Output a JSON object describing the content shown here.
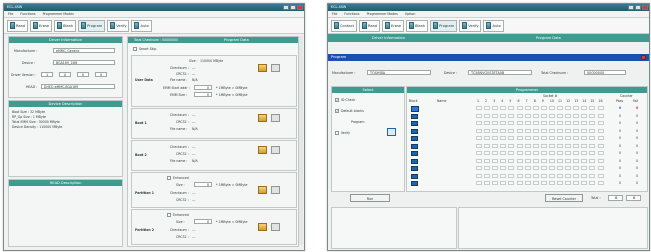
{
  "left_window": {
    "title": "ECL-4SW",
    "menu": [
      "File",
      "Functions",
      "Programmer Modes"
    ],
    "toolbar": [
      "Read",
      "Erase",
      "Blank",
      "Program",
      "Verify",
      "Auto"
    ],
    "driver_info": {
      "header": "Driver Information",
      "manufacturer_label": "Manufacturer :",
      "manufacturer_value": "eMMC_Generic",
      "device_label": "Device :",
      "device_value": "BGA169_16M",
      "driver_version_label": "Driver Version :",
      "driver_version_values": [
        "1",
        "0",
        "0",
        "0"
      ],
      "head_label": "HEAD :",
      "head_value": "DHEO-eMMC-BGA169"
    },
    "device_description": {
      "header": "Device Description",
      "lines": [
        "Boot Size : 32 MByte",
        "RP_Gp Size : 1 MByte",
        "Total EMM Size : 30000 MByte",
        "Device Density : 110000 MByte"
      ]
    },
    "head_description": {
      "header": "HEAD Description"
    },
    "prog_data": {
      "header": "Program Data",
      "total_checksum_label": "Total Checksum :",
      "total_checksum_value": "00000000",
      "smart_skip_label": "Smart Skip",
      "user_data": {
        "label": "User Data",
        "size_label": "Size :",
        "size_value": "110000 MByte",
        "checksum_label": "Checksum :",
        "checksum_value": "---",
        "crc32_label": "CRC32 :",
        "crc32_value": "---",
        "filename_label": "File name :",
        "filename_value": "N/A",
        "emm_start_label": "EMM Start addr :",
        "emm_start_value": "0",
        "emm_size_label": "EMM Size :",
        "emm_size_value": "0",
        "unit_text": "* 1MByte = 0MByte"
      },
      "boot1": {
        "label": "Boot 1",
        "checksum_label": "Checksum :",
        "checksum_value": "---",
        "crc32_label": "CRC32 :",
        "crc32_value": "---",
        "filename_label": "File name :",
        "filename_value": "N/A"
      },
      "boot2": {
        "label": "Boot 2",
        "checksum_label": "Checksum :",
        "checksum_value": "---",
        "crc32_label": "CRC32 :",
        "crc32_value": "---",
        "filename_label": "File name :",
        "filename_value": "N/A"
      },
      "partition1": {
        "label": "Partition 1",
        "enhanced_label": "Enhanced",
        "size_label": "Size :",
        "size_value": "0",
        "unit_text": "* 1MByte = 0MByte",
        "checksum_label": "Checksum :",
        "checksum_value": "---",
        "crc32_label": "CRC32 :",
        "crc32_value": "---"
      },
      "partition2": {
        "label": "Partition 2",
        "enhanced_label": "Enhanced",
        "size_label": "Size :",
        "size_value": "0",
        "unit_text": "* 1MByte = 0MByte",
        "checksum_label": "Checksum :",
        "checksum_value": "---",
        "crc32_label": "CRC32 :",
        "crc32_value": "---"
      }
    }
  },
  "right_window": {
    "title": "ECL-4SW",
    "menu": [
      "File",
      "Functions",
      "Programmer Modes",
      "Option"
    ],
    "toolbar": [
      "Contact",
      "Read",
      "Erase",
      "Blank",
      "Program",
      "Verify",
      "Auto"
    ],
    "driver_info_header": "Driver Information",
    "prog_data_header": "Program Data",
    "program_title": "Program",
    "manufacturer_label": "Manufacturer :",
    "manufacturer_value": "TOSHIBA",
    "device_label": "Device :",
    "device_value": "TC58NVG0S3ETA0B",
    "total_checksum_label": "Total Checksum :",
    "total_checksum_value": "00000000",
    "select_header": "Select",
    "select_items": [
      "ID Check",
      "Default blocks",
      "Program",
      "Verify"
    ],
    "programmer_header": "Programmer",
    "socket_label": "Socket #",
    "counter_label": "Counter",
    "col_block": "Block",
    "col_name": "Name",
    "socket_numbers": [
      "1",
      "2",
      "3",
      "4",
      "5",
      "6",
      "7",
      "8",
      "9",
      "10",
      "11",
      "12",
      "13",
      "14",
      "15",
      "16"
    ],
    "col_pass": "Pass",
    "col_fail": "Fail",
    "row1_pass": "0",
    "row1_fail": "0",
    "zero": "0",
    "run_button": "Run",
    "reset_counter_button": "Reset Counter",
    "total_label": "Total :",
    "total_pass": "0",
    "total_fail": "0",
    "colors": {
      "teal": "#3f9a8f",
      "blue_bar": "#1d4fb3",
      "pass": "#1f62c9",
      "fail": "#c9302c"
    }
  }
}
